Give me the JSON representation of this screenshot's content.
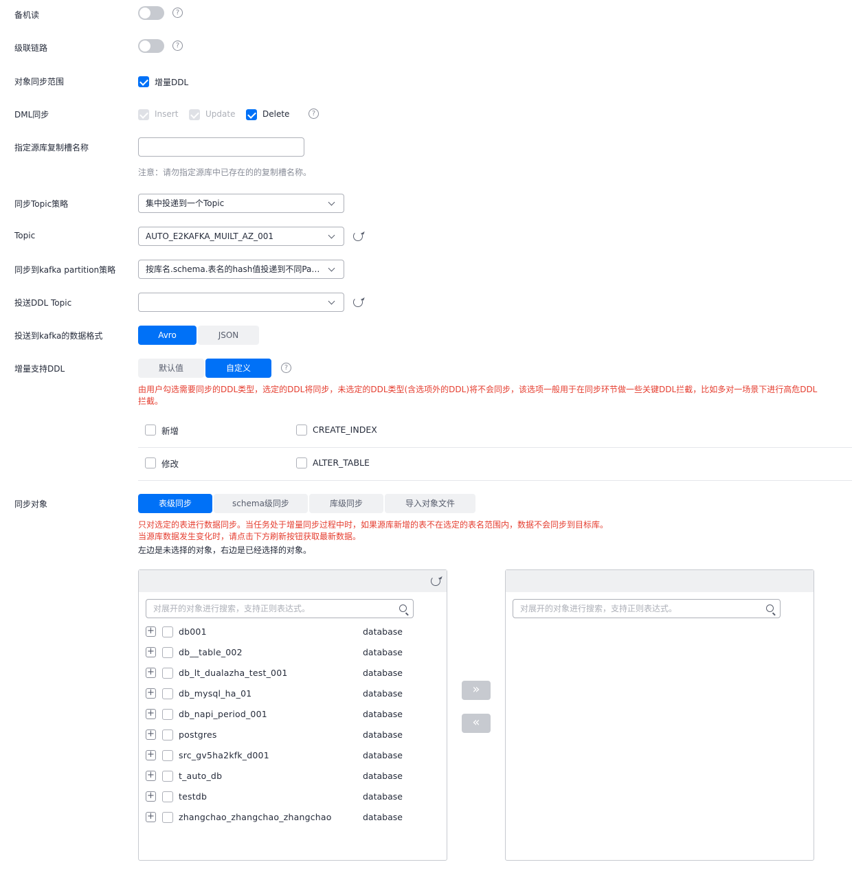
{
  "standby_read": {
    "label": "备机读",
    "enabled": false
  },
  "cascade_link": {
    "label": "级联链路",
    "enabled": false
  },
  "sync_scope": {
    "label": "对象同步范围",
    "option": "增量DDL",
    "checked": true
  },
  "dml_sync": {
    "label": "DML同步",
    "insert": "Insert",
    "update": "Update",
    "delete": "Delete"
  },
  "slot_name": {
    "label": "指定源库复制槽名称",
    "value": "",
    "note": "注意：请勿指定源库中已存在的的复制槽名称。"
  },
  "topic_strategy": {
    "label": "同步Topic策略",
    "value": "集中投递到一个Topic"
  },
  "topic": {
    "label": "Topic",
    "value": "AUTO_E2KAFKA_MUILT_AZ_001"
  },
  "partition_strategy": {
    "label": "同步到kafka partition策略",
    "value": "按库名.schema.表名的hash值投递到不同Par..."
  },
  "ddl_topic": {
    "label": "投送DDL Topic",
    "value": ""
  },
  "data_format": {
    "label": "投送到kafka的数据格式",
    "options": [
      "Avro",
      "JSON"
    ],
    "selected": "Avro"
  },
  "ddl_support": {
    "label": "增量支持DDL",
    "options": [
      "默认值",
      "自定义"
    ],
    "selected": "自定义",
    "note": "由用户勾选需要同步的DDL类型，选定的DDL将同步，未选定的DDL类型(含选项外的DDL)将不会同步，该选项一般用于在同步环节做一些关键DDL拦截，比如多对一场景下进行高危DDL拦截。",
    "types": [
      "新增",
      "CREATE_INDEX",
      "修改",
      "ALTER_TABLE"
    ]
  },
  "sync_objects": {
    "label": "同步对象",
    "tabs": [
      "表级同步",
      "schema级同步",
      "库级同步",
      "导入对象文件"
    ],
    "active_tab": "表级同步",
    "warning1": "只对选定的表进行数据同步。当任务处于增量同步过程中时，如果源库新增的表不在选定的表名范围内，数据不会同步到目标库。",
    "warning2": "当源库数据发生变化时，请点击下方刷新按钮获取最新数据。",
    "hint": "左边是未选择的对象，右边是已经选择的对象。",
    "search_placeholder": "对展开的对象进行搜索，支持正则表达式。",
    "items": [
      {
        "name": "db001",
        "type": "database"
      },
      {
        "name": "db__table_002",
        "type": "database"
      },
      {
        "name": "db_lt_dualazha_test_001",
        "type": "database"
      },
      {
        "name": "db_mysql_ha_01",
        "type": "database"
      },
      {
        "name": "db_napi_period_001",
        "type": "database"
      },
      {
        "name": "postgres",
        "type": "database"
      },
      {
        "name": "src_gv5ha2kfk_d001",
        "type": "database"
      },
      {
        "name": "t_auto_db",
        "type": "database"
      },
      {
        "name": "testdb",
        "type": "database"
      },
      {
        "name": "zhangchao_zhangchao_zhangchao",
        "type": "database"
      }
    ]
  },
  "colors": {
    "primary": "#0071f7",
    "danger": "#e53e30",
    "muted": "#8a8e99"
  }
}
